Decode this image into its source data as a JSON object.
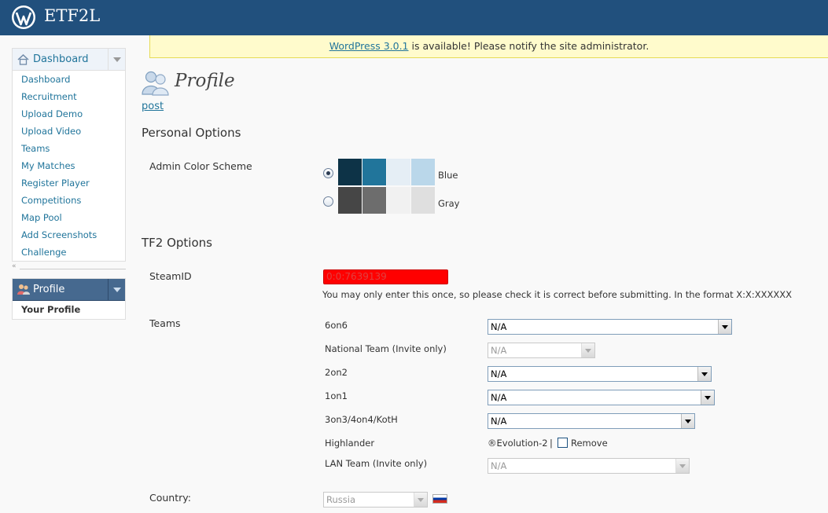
{
  "header": {
    "site_title": "ETF2L",
    "logo_icon": "wordpress-logo-icon"
  },
  "notice": {
    "link_text": "WordPress 3.0.1",
    "text": " is available! Please notify the site administrator."
  },
  "sidebar": {
    "dashboard_label": "Dashboard",
    "items": [
      "Dashboard",
      "Recruitment",
      "Upload Demo",
      "Upload Video",
      "Teams",
      "My Matches",
      "Register Player",
      "Competitions",
      "Map Pool",
      "Add Screenshots",
      "Challenge"
    ],
    "profile_label": "Profile",
    "profile_items": [
      "Your Profile"
    ]
  },
  "page": {
    "title": "Profile",
    "sub_link": "post"
  },
  "personal_options": {
    "heading": "Personal Options",
    "color_scheme_label": "Admin Color Scheme",
    "schemes": [
      {
        "name": "Blue",
        "selected": true,
        "colors": [
          "#0d3347",
          "#21759b",
          "#e5eef5",
          "#bad7ea"
        ]
      },
      {
        "name": "Gray",
        "selected": false,
        "colors": [
          "#464646",
          "#6d6d6d",
          "#f1f1f1",
          "#dfdfdf"
        ]
      }
    ]
  },
  "tf2_options": {
    "heading": "TF2 Options",
    "steamid_label": "SteamID",
    "steamid_value": "0:0:7639139",
    "steamid_hint": "You may only enter this once, so please check it is correct before submitting. In the format X:X:XXXXXX",
    "teams_label": "Teams",
    "teams": [
      {
        "label": "6on6",
        "value": "N/A",
        "disabled": false
      },
      {
        "label": "National Team (Invite only)",
        "value": "N/A",
        "disabled": true
      },
      {
        "label": "2on2",
        "value": "N/A",
        "disabled": false
      },
      {
        "label": "1on1",
        "value": "N/A",
        "disabled": false
      },
      {
        "label": "3on3/4on4/KotH",
        "value": "N/A",
        "disabled": false
      },
      {
        "label": "Highlander",
        "team_name": "®Evolution-2",
        "separator": "|",
        "remove_label": "Remove"
      },
      {
        "label": "LAN Team (Invite only)",
        "value": "N/A",
        "disabled": true
      }
    ],
    "country_label": "Country:",
    "country_value": "Russia",
    "country_flag_colors": [
      "#ffffff",
      "#0039a6",
      "#d52b1e"
    ]
  },
  "colors": {
    "header_bg": "#21507d",
    "link": "#21759b",
    "notice_bg": "#fffbcc",
    "steamid_error": "#ff0000"
  }
}
